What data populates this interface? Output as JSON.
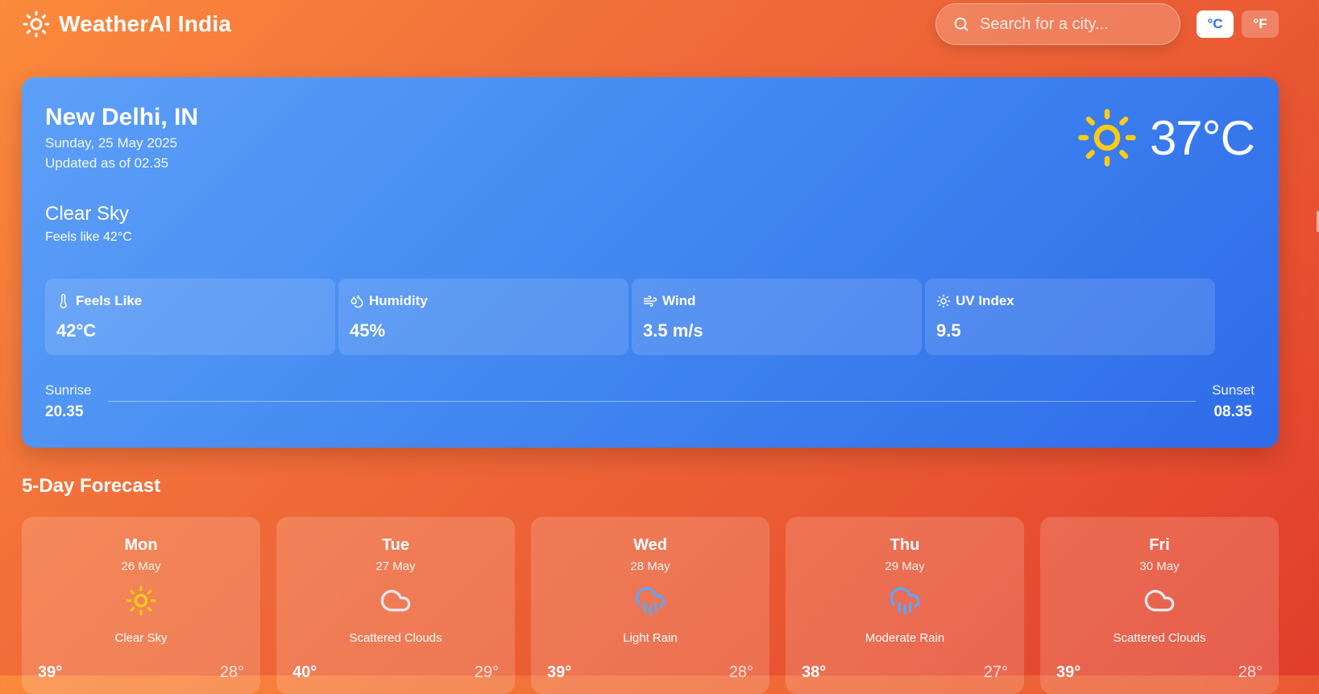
{
  "header": {
    "brand_icon": "sun-icon",
    "brand_title": "WeatherAI India",
    "search_placeholder": "Search for a city...",
    "unit_celsius": "°C",
    "unit_fahrenheit": "°F",
    "active_unit": "°C"
  },
  "current": {
    "city": "New Delhi, IN",
    "date": "Sunday, 25 May 2025",
    "updated": "Updated as of 02.35",
    "condition": "Clear Sky",
    "feels_like_text": "Feels like 42°C",
    "temperature": "37°C",
    "icon": "sun-icon",
    "stats": [
      {
        "label": "Feels Like",
        "value": "42°C",
        "icon": "thermometer-icon"
      },
      {
        "label": "Humidity",
        "value": "45%",
        "icon": "droplets-icon"
      },
      {
        "label": "Wind",
        "value": "3.5 m/s",
        "icon": "wind-icon"
      },
      {
        "label": "UV Index",
        "value": "9.5",
        "icon": "sun-small-icon"
      }
    ],
    "sunrise_label": "Sunrise",
    "sunrise_time": "20.35",
    "sunset_label": "Sunset",
    "sunset_time": "08.35"
  },
  "forecast": {
    "title": "5-Day Forecast",
    "days": [
      {
        "day": "Mon",
        "date": "26 May",
        "desc": "Clear Sky",
        "hi": "39°",
        "lo": "28°",
        "icon": "sun-icon"
      },
      {
        "day": "Tue",
        "date": "27 May",
        "desc": "Scattered Clouds",
        "hi": "40°",
        "lo": "29°",
        "icon": "cloud-icon"
      },
      {
        "day": "Wed",
        "date": "28 May",
        "desc": "Light Rain",
        "hi": "39°",
        "lo": "28°",
        "icon": "cloud-rain-icon"
      },
      {
        "day": "Thu",
        "date": "29 May",
        "desc": "Moderate Rain",
        "hi": "38°",
        "lo": "27°",
        "icon": "cloud-rain-icon"
      },
      {
        "day": "Fri",
        "date": "30 May",
        "desc": "Scattered Clouds",
        "hi": "39°",
        "lo": "28°",
        "icon": "cloud-icon"
      }
    ]
  },
  "colors": {
    "background_start": "#fb8a3c",
    "background_end": "#e23d2b",
    "card_blue": "#3b82f6",
    "sun_yellow": "#facc15",
    "rain_blue": "#60a5fa",
    "active_unit_text": "#2f6fea"
  }
}
